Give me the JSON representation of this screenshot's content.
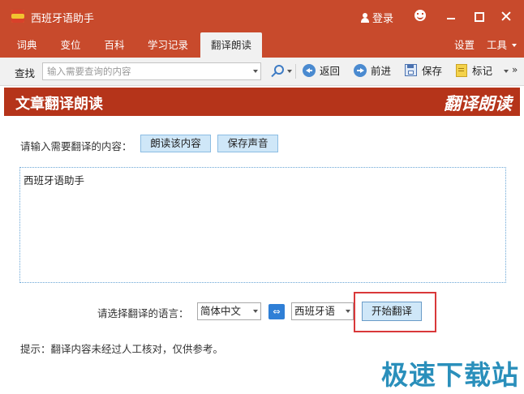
{
  "window": {
    "title": "西班牙语助手",
    "login_label": "登录"
  },
  "menu": {
    "tabs": [
      {
        "label": "词典"
      },
      {
        "label": "变位"
      },
      {
        "label": "百科"
      },
      {
        "label": "学习记录"
      },
      {
        "label": "翻译朗读",
        "active": true
      }
    ],
    "settings_label": "设置",
    "tools_label": "工具"
  },
  "toolbar": {
    "search_label": "查找",
    "search_placeholder": "输入需要查询的内容",
    "back_label": "返回",
    "forward_label": "前进",
    "save_label": "保存",
    "mark_label": "标记",
    "more_label": "»"
  },
  "banner": {
    "title": "文章翻译朗读",
    "brand": "翻译朗读"
  },
  "translate": {
    "prompt": "请输入需要翻译的内容：",
    "read_button": "朗读该内容",
    "save_audio_button": "保存声音",
    "input_text": "西班牙语助手",
    "lang_label": "请选择翻译的语言：",
    "source_lang": "简体中文",
    "swap_label": "⇔",
    "target_lang": "西班牙语",
    "start_button": "开始翻译",
    "hint": "提示：翻译内容未经过人工核对，仅供参考。"
  },
  "watermark": "极速下载站",
  "colors": {
    "title_bar": "#c84a2c",
    "banner": "#b5341a",
    "button_fill": "#cfe7f8",
    "highlight_border": "#d9383a",
    "watermark": "#1f8ab8"
  }
}
